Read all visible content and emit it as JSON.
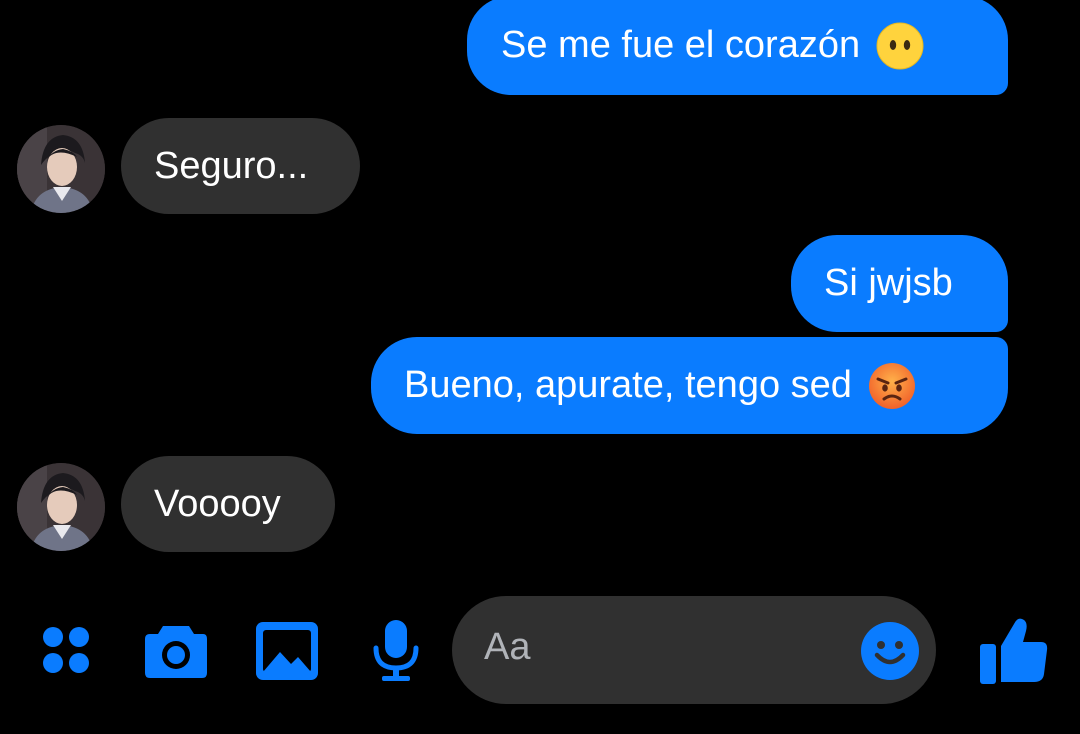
{
  "messages": [
    {
      "sender": "me",
      "text": "Se me fue el corazón",
      "emoji": "neutral-face-emoji"
    },
    {
      "sender": "contact",
      "text": "Seguro..."
    },
    {
      "sender": "me",
      "text": "Si jwjsb"
    },
    {
      "sender": "me",
      "text": "Bueno, apurate, tengo sed",
      "emoji": "angry-face-emoji"
    },
    {
      "sender": "contact",
      "text": "Vooooy"
    }
  ],
  "composer": {
    "placeholder": "Aa",
    "icons": [
      "menu-icon",
      "camera-icon",
      "image-icon",
      "microphone-icon",
      "emoji-icon",
      "thumbs-up-icon"
    ]
  },
  "colors": {
    "background": "#000000",
    "outgoing_bubble": "#0a7cff",
    "incoming_bubble": "#303030",
    "accent": "#0a7cff",
    "placeholder_text": "#b0b3b8"
  }
}
